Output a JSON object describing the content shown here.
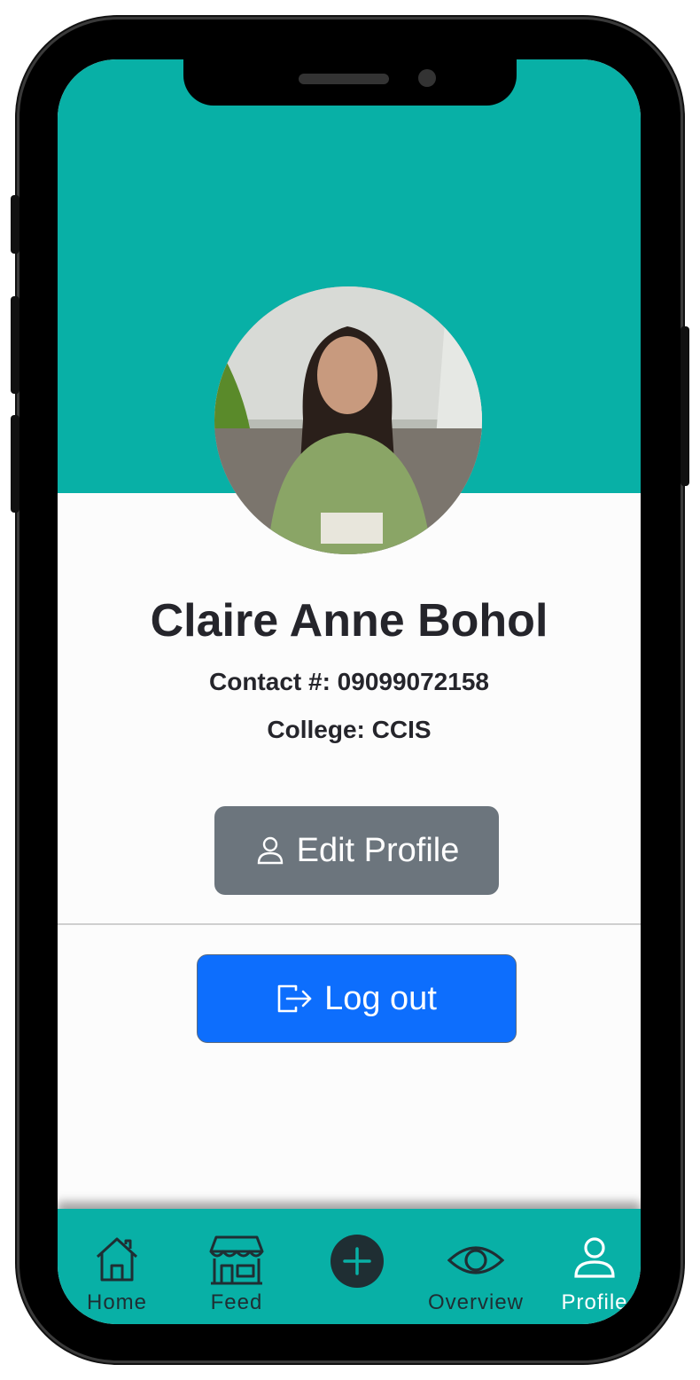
{
  "profile": {
    "name": "Claire Anne Bohol",
    "contact": "Contact #: 09099072158",
    "college": "College: CCIS"
  },
  "actions": {
    "edit_label": "Edit Profile",
    "logout_label": "Log out"
  },
  "nav": {
    "items": [
      {
        "label": "Home",
        "icon": "home-icon"
      },
      {
        "label": "Feed",
        "icon": "store-icon"
      },
      {
        "label": "",
        "icon": "plus-circle-icon"
      },
      {
        "label": "Overview",
        "icon": "eye-icon"
      },
      {
        "label": "Profile",
        "icon": "user-icon",
        "active": true
      }
    ]
  },
  "colors": {
    "header": "#08b0a6",
    "edit_button": "#6c757d",
    "logout_button": "#0d6efd",
    "text": "#25252b"
  }
}
